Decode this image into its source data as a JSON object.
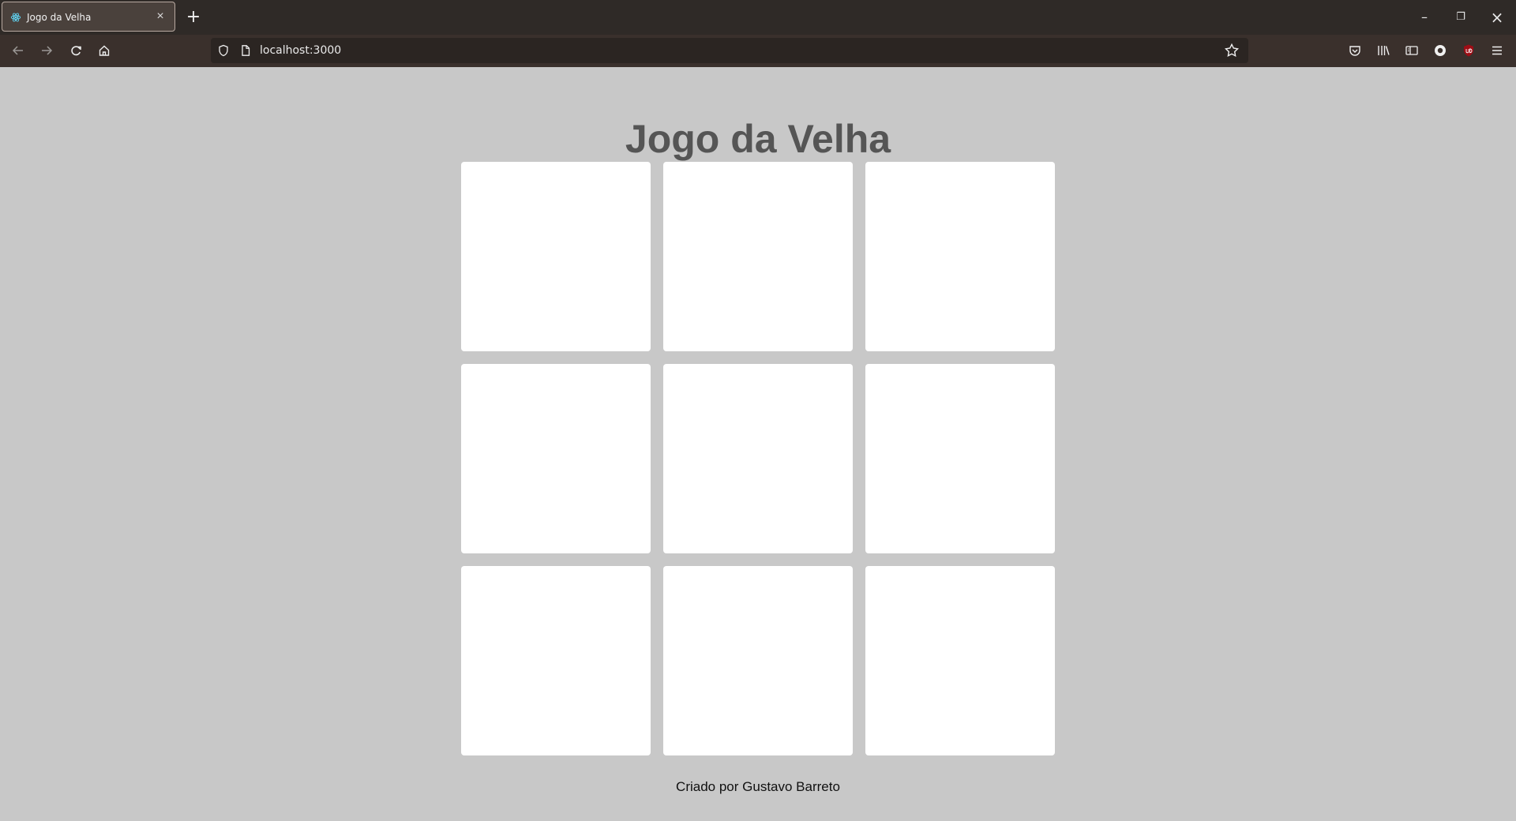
{
  "browser": {
    "tab": {
      "title": "Jogo da Velha",
      "close_label": "×",
      "new_tab_label": "+"
    },
    "window_controls": {
      "minimize": "–",
      "restore": "❐",
      "close": "×"
    },
    "address": {
      "url": "localhost:3000"
    }
  },
  "page": {
    "title": "Jogo da Velha",
    "footer": "Criado por Gustavo Barreto",
    "board": {
      "cells": [
        "",
        "",
        "",
        "",
        "",
        "",
        "",
        "",
        ""
      ]
    }
  },
  "colors": {
    "background": "#c8c8c8",
    "cell_background": "#ffffff",
    "title_text": "#555555",
    "footer_text": "#111111",
    "browser_tabbar": "#2f2a27",
    "browser_toolbar": "#3a302c"
  },
  "icons": {
    "tab_favicon": "react-atom-icon",
    "back": "arrow-left-icon",
    "forward": "arrow-right-icon",
    "reload": "reload-icon",
    "home": "home-icon",
    "shield": "shield-icon",
    "page": "page-icon",
    "bookmark": "star-icon",
    "pocket": "pocket-icon",
    "library": "library-icon",
    "sidebar": "sidebar-icon",
    "account": "account-icon",
    "ublock": "ublock-icon",
    "menu": "hamburger-menu-icon"
  }
}
